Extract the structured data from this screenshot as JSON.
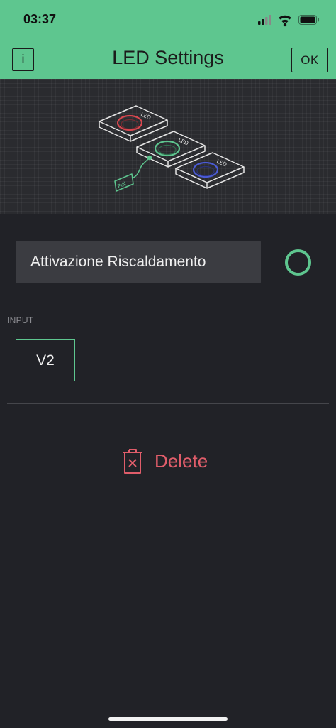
{
  "status_bar": {
    "time": "03:37",
    "icons": [
      "cellular-signal-icon",
      "wifi-icon",
      "battery-icon"
    ]
  },
  "nav": {
    "title": "LED Settings",
    "info_label": "i",
    "ok_label": "OK"
  },
  "illustration": {
    "led_label": "LED",
    "pin_label": "PIN",
    "led_colors": [
      "#d9474f",
      "#5ec68f",
      "#4b5bd6"
    ]
  },
  "widget": {
    "name_value": "Attivazione Riscaldamento",
    "color": "#5ec68f"
  },
  "input_section": {
    "label": "INPUT",
    "pin_value": "V2"
  },
  "delete": {
    "label": "Delete",
    "color": "#e05d6a"
  },
  "theme": {
    "accent": "#5ec68f",
    "background": "#212227"
  }
}
